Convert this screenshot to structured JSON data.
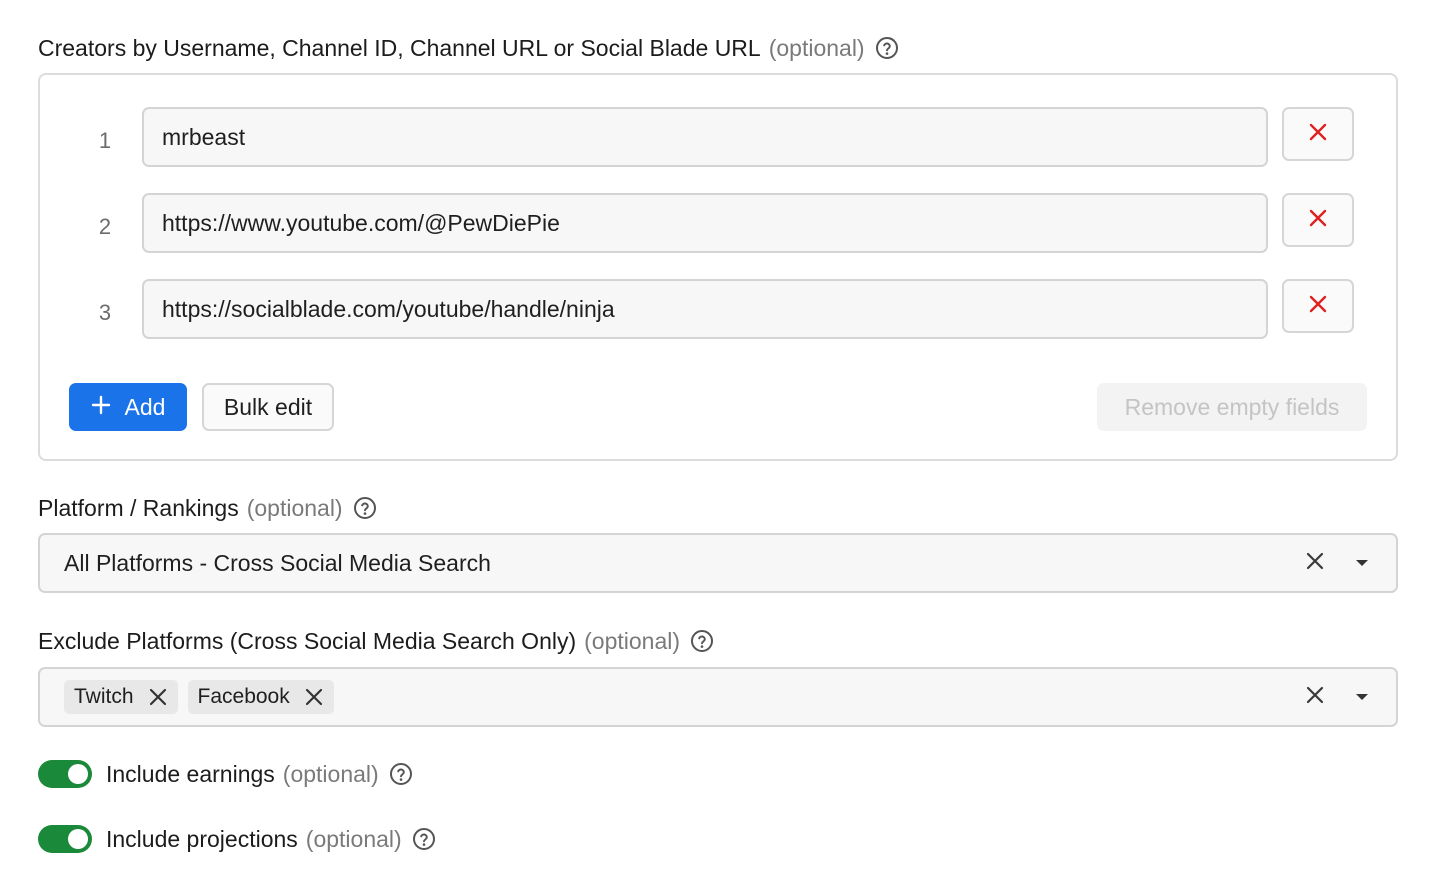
{
  "creators": {
    "label": "Creators by Username, Channel ID, Channel URL or Social Blade URL",
    "optional": "(optional)",
    "rows": [
      {
        "index": "1",
        "value": "mrbeast"
      },
      {
        "index": "2",
        "value": "https://www.youtube.com/@PewDiePie"
      },
      {
        "index": "3",
        "value": "https://socialblade.com/youtube/handle/ninja"
      }
    ],
    "add_label": "Add",
    "bulk_edit_label": "Bulk edit",
    "remove_empty_label": "Remove empty fields"
  },
  "platform": {
    "label": "Platform / Rankings",
    "optional": "(optional)",
    "selected": "All Platforms - Cross Social Media Search"
  },
  "exclude": {
    "label": "Exclude Platforms (Cross Social Media Search Only)",
    "optional": "(optional)",
    "tags": [
      "Twitch",
      "Facebook"
    ]
  },
  "toggles": {
    "earnings": {
      "label": "Include earnings",
      "optional": "(optional)",
      "on": true
    },
    "projections": {
      "label": "Include projections",
      "optional": "(optional)",
      "on": true
    }
  },
  "colors": {
    "primary": "#1a73e8",
    "danger": "#e02020",
    "toggle_on": "#1a8a3a"
  },
  "icons": {
    "help": "help-circle-icon",
    "remove": "close-icon",
    "add": "plus-icon",
    "caret": "caret-down-icon"
  }
}
